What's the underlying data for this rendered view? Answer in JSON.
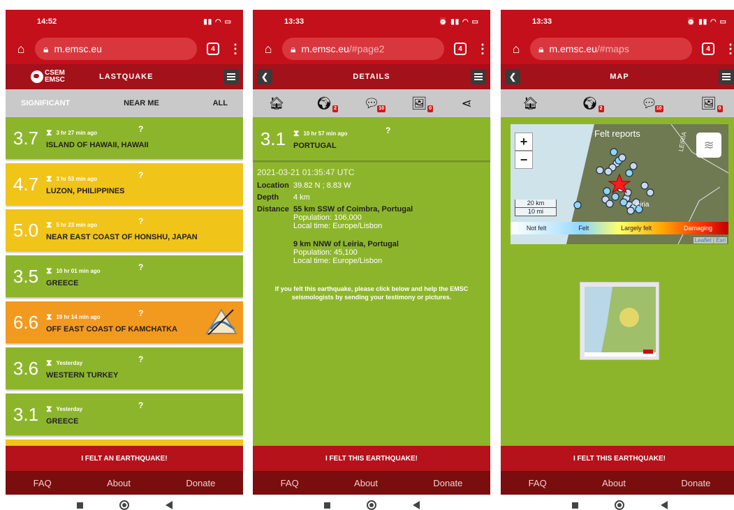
{
  "phone1": {
    "status_time": "14:52",
    "url": {
      "domain": "m.emsc.eu",
      "path": ""
    },
    "tab_count": "4",
    "logo_text": [
      "CSEM",
      "EMSC"
    ],
    "header_title": "LASTQUAKE",
    "filters": [
      {
        "label": "SIGNIFICANT",
        "active": true
      },
      {
        "label": "NEAR ME",
        "active": false
      },
      {
        "label": "ALL",
        "active": false
      }
    ],
    "quakes": [
      {
        "mag": "3.7",
        "time": "3 hr 27 min ago",
        "place": "ISLAND OF HAWAII, HAWAII",
        "color": "#8db52c",
        "tsunami": false
      },
      {
        "mag": "4.7",
        "time": "3 hr 53 min ago",
        "place": "LUZON, PHILIPPINES",
        "color": "#f0c419",
        "tsunami": false
      },
      {
        "mag": "5.0",
        "time": "5 hr 23 min ago",
        "place": "NEAR EAST COAST OF HONSHU, JAPAN",
        "color": "#f0c419",
        "tsunami": false
      },
      {
        "mag": "3.5",
        "time": "10 hr 01 min ago",
        "place": "GREECE",
        "color": "#8db52c",
        "tsunami": false
      },
      {
        "mag": "6.6",
        "time": "19 hr 14 min ago",
        "place": "OFF EAST COAST OF KAMCHATKA",
        "color": "#f2991f",
        "tsunami": true
      },
      {
        "mag": "3.6",
        "time": "Yesterday",
        "place": "WESTERN TURKEY",
        "color": "#8db52c",
        "tsunami": false
      },
      {
        "mag": "3.1",
        "time": "Yesterday",
        "place": "GREECE",
        "color": "#8db52c",
        "tsunami": false
      }
    ],
    "felt_button": "I FELT AN EARTHQUAKE!",
    "footer": [
      "FAQ",
      "About",
      "Donate"
    ]
  },
  "phone2": {
    "status_time": "13:33",
    "url": {
      "domain": "m.emsc.eu",
      "path": "/#page2"
    },
    "tab_count": "4",
    "header_title": "DETAILS",
    "icon_badges": {
      "globe": "2",
      "comments": "10",
      "pictures": "0"
    },
    "quake": {
      "mag": "3.1",
      "time": "10 hr 57 min ago",
      "place": "PORTUGAL"
    },
    "timestamp": "2021-03-21   01:35:47 UTC",
    "location_label": "Location",
    "location_value": "39.82 N ; 8.83 W",
    "depth_label": "Depth",
    "depth_value": "4 km",
    "distance_label": "Distance",
    "distances": [
      {
        "city": "55 km SSW of Coimbra, Portugal",
        "population": "Population: 106,000",
        "local_time": "Local time: Europe/Lisbon"
      },
      {
        "city": "9 km NNW of Leiria, Portugal",
        "population": "Population: 45,100",
        "local_time": "Local time: Europe/Lisbon"
      }
    ],
    "help_text": "If you felt this earthquake, please click below and help the EMSC seismologists by sending your testimony or pictures.",
    "felt_button": "I FELT THIS EARTHQUAKE!",
    "footer": [
      "FAQ",
      "About",
      "Donate"
    ]
  },
  "phone3": {
    "status_time": "13:33",
    "url": {
      "domain": "m.emsc.eu",
      "path": "/#maps"
    },
    "tab_count": "4",
    "header_title": "MAP",
    "icon_badges": {
      "globe": "2",
      "comments": "10",
      "pictures": "0"
    },
    "map": {
      "title": "Felt reports",
      "zoom_in": "+",
      "zoom_out": "−",
      "scale_km": "20 km",
      "scale_mi": "10 mi",
      "place_label": "Leiria",
      "region_label": "LEIRIA",
      "legend": [
        "Not felt",
        "Felt",
        "Largely felt",
        "Damaging"
      ],
      "attribution": "Leaflet | Esri"
    },
    "felt_button": "I FELT THIS EARTHQUAKE!",
    "footer": [
      "FAQ",
      "About",
      "Donate"
    ]
  },
  "colors": {
    "brand_red": "#c4101a",
    "dark_red": "#a3111a",
    "footer_red": "#7a0d0d",
    "green": "#8db52c",
    "yellow": "#f0c419",
    "orange": "#f2991f"
  }
}
